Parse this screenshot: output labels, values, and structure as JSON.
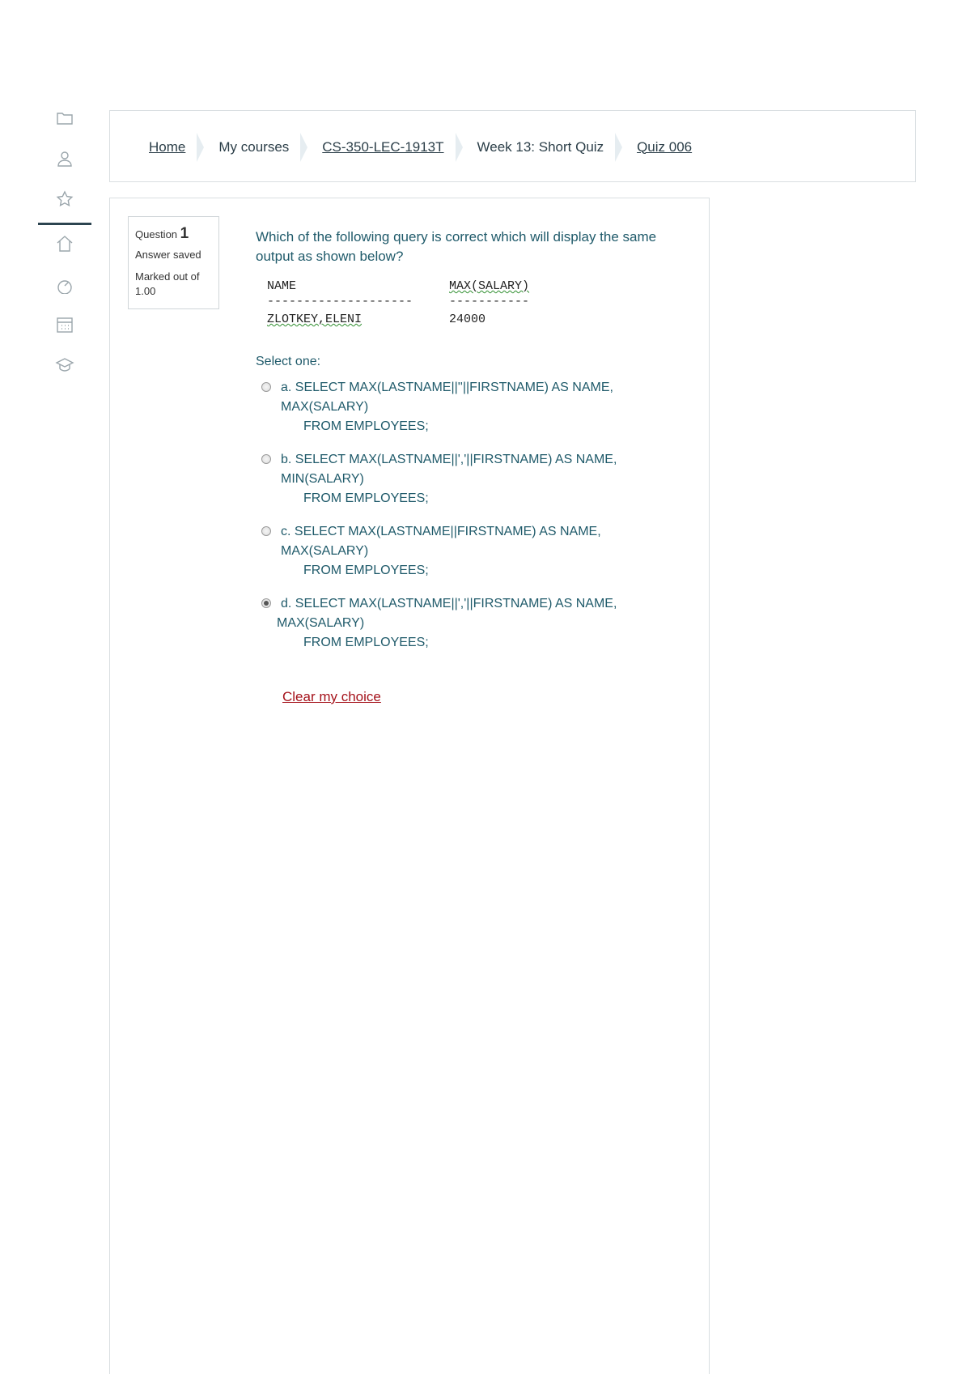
{
  "breadcrumb": {
    "items": [
      {
        "label": "Home",
        "link": true
      },
      {
        "label": "My courses",
        "link": false
      },
      {
        "label": "CS-350-LEC-1913T",
        "link": true
      },
      {
        "label": "Week 13: Short Quiz",
        "link": false
      },
      {
        "label": "Quiz 006",
        "link": true
      }
    ]
  },
  "sidebar": {
    "icons": [
      "folder-icon",
      "user-icon",
      "star-icon",
      "home-icon",
      "dashboard-icon",
      "calendar-icon",
      "graduation-cap-icon"
    ]
  },
  "question": {
    "label": "Question",
    "number": "1",
    "state": "Answer saved",
    "marks": "Marked out of 1.00",
    "text": "Which of the following query is correct which will display the same output as shown below?",
    "output": {
      "header_name": "NAME",
      "header_max": "MAX(SALARY)",
      "divider_name": "--------------------",
      "divider_max": "-----------",
      "value_name": "ZLOTKEY,ELENI",
      "value_max": "24000"
    },
    "prompt": "Select one:",
    "options": [
      {
        "letter": "a.",
        "line1": "SELECT MAX(LASTNAME||''||FIRSTNAME) AS NAME, MAX(SALARY)",
        "line2": "FROM EMPLOYEES;",
        "selected": false
      },
      {
        "letter": "b.",
        "line1": "SELECT MAX(LASTNAME||','||FIRSTNAME) AS NAME, MIN(SALARY)",
        "line2": "FROM EMPLOYEES;",
        "selected": false
      },
      {
        "letter": "c.",
        "line1": "SELECT MAX(LASTNAME||FIRSTNAME) AS NAME, MAX(SALARY)",
        "line2": "FROM EMPLOYEES;",
        "selected": false
      },
      {
        "letter": "d.",
        "line1": "SELECT MAX(LASTNAME||','||FIRSTNAME) AS NAME,",
        "line1b": "MAX(SALARY)",
        "line2": "FROM EMPLOYEES;",
        "selected": true
      }
    ],
    "clear_label": "Clear my choice"
  },
  "colors": {
    "accent_text": "#1f5a6a",
    "clear_link": "#a5121b",
    "rail_active": "#2c4450"
  }
}
